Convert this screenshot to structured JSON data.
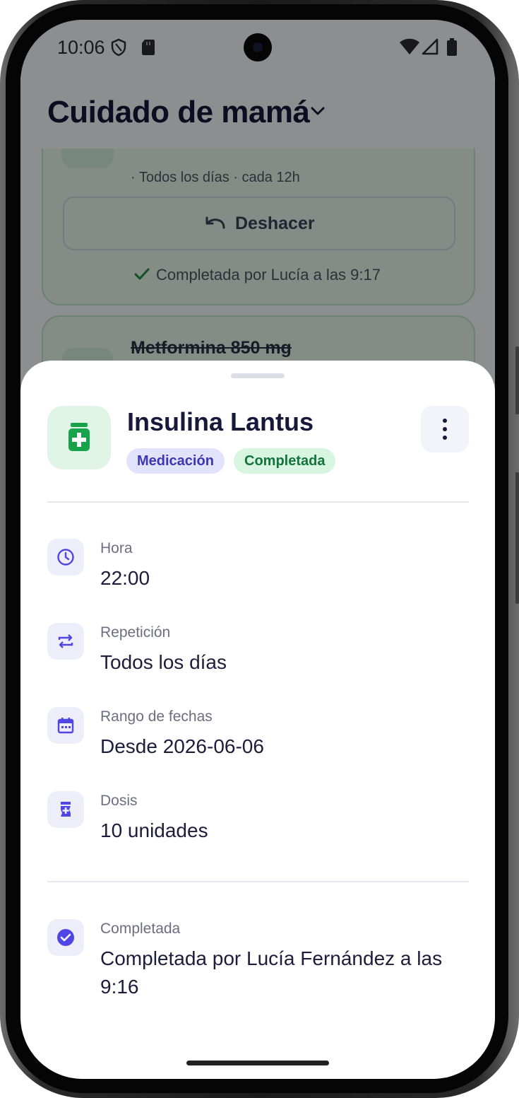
{
  "status_bar": {
    "time": "10:06"
  },
  "app": {
    "title": "Cuidado de mamá",
    "list": {
      "completed_task": {
        "schedule": "· Todos los días · cada 12h",
        "undo_label": "Deshacer",
        "completed_note": "Completada por Lucía a las 9:17"
      },
      "next_task": {
        "title": "Metformina 850 mg"
      }
    }
  },
  "sheet": {
    "title": "Insulina Lantus",
    "chips": {
      "category": "Medicación",
      "status": "Completada"
    },
    "details": [
      {
        "label": "Hora",
        "value": "22:00",
        "icon": "clock-icon"
      },
      {
        "label": "Repetición",
        "value": "Todos los días",
        "icon": "repeat-icon"
      },
      {
        "label": "Rango de fechas",
        "value": "Desde 2026-06-06",
        "icon": "calendar-icon"
      },
      {
        "label": "Dosis",
        "value": "10 unidades",
        "icon": "medication-icon"
      }
    ],
    "completion": {
      "label": "Completada",
      "value": "Completada por Lucía Fernández a las 9:16",
      "icon": "check-circle-icon"
    }
  },
  "colors": {
    "accent": "#4f46e5",
    "success": "#16a34a",
    "title": "#17183a",
    "chip_category_bg": "#e3e2fb",
    "chip_status_bg": "#d8f5e1"
  }
}
